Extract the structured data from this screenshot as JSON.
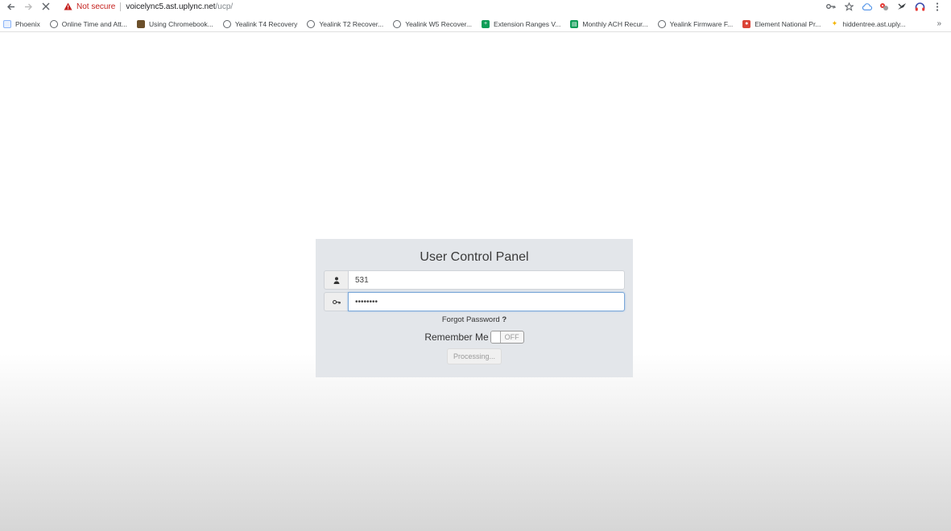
{
  "browser": {
    "security_label": "Not secure",
    "url_host": "voicelync5.ast.uplync.net",
    "url_path": "/ucp/",
    "nav": {
      "back_icon": "arrow-left-icon",
      "forward_icon": "arrow-right-icon",
      "stop_icon": "close-icon"
    },
    "right_icons": [
      "key-icon",
      "star-icon",
      "cloud-icon",
      "extension-icon",
      "bird-icon",
      "headset-icon",
      "kebab-menu-icon"
    ]
  },
  "bookmarks": [
    {
      "label": "Phoenix",
      "icon": "doc-icon",
      "color": "#8ab4f8"
    },
    {
      "label": "Online Time and Att...",
      "icon": "globe-icon",
      "color": "#5f6368"
    },
    {
      "label": "Using Chromebook...",
      "icon": "photo-icon",
      "color": "#6b4f2a"
    },
    {
      "label": "Yealink T4 Recovery",
      "icon": "globe-icon",
      "color": "#5f6368"
    },
    {
      "label": "Yealink T2 Recover...",
      "icon": "globe-icon",
      "color": "#5f6368"
    },
    {
      "label": "Yealink W5 Recover...",
      "icon": "globe-icon",
      "color": "#5f6368"
    },
    {
      "label": "Extension Ranges V...",
      "icon": "sheets-plus-icon",
      "color": "#0f9d58"
    },
    {
      "label": "Monthly ACH Recur...",
      "icon": "sheets-icon",
      "color": "#0f9d58"
    },
    {
      "label": "Yealink Firmware F...",
      "icon": "globe-icon",
      "color": "#5f6368"
    },
    {
      "label": "Element National Pr...",
      "icon": "map-pin-icon",
      "color": "#db4437"
    },
    {
      "label": "hiddentree.ast.uply...",
      "icon": "sparkle-icon",
      "color": "#f4b400"
    }
  ],
  "bookmarks_overflow": "»",
  "login": {
    "title": "User Control Panel",
    "username_value": "531",
    "password_value": "••••••••",
    "forgot_label": "Forgot Password",
    "forgot_mark": "?",
    "remember_label": "Remember Me",
    "toggle_state": "OFF",
    "submit_label": "Processing..."
  },
  "colors": {
    "panel_bg": "#e3e6ea",
    "not_secure": "#c5221f",
    "focus_border": "#7aa7d8"
  }
}
